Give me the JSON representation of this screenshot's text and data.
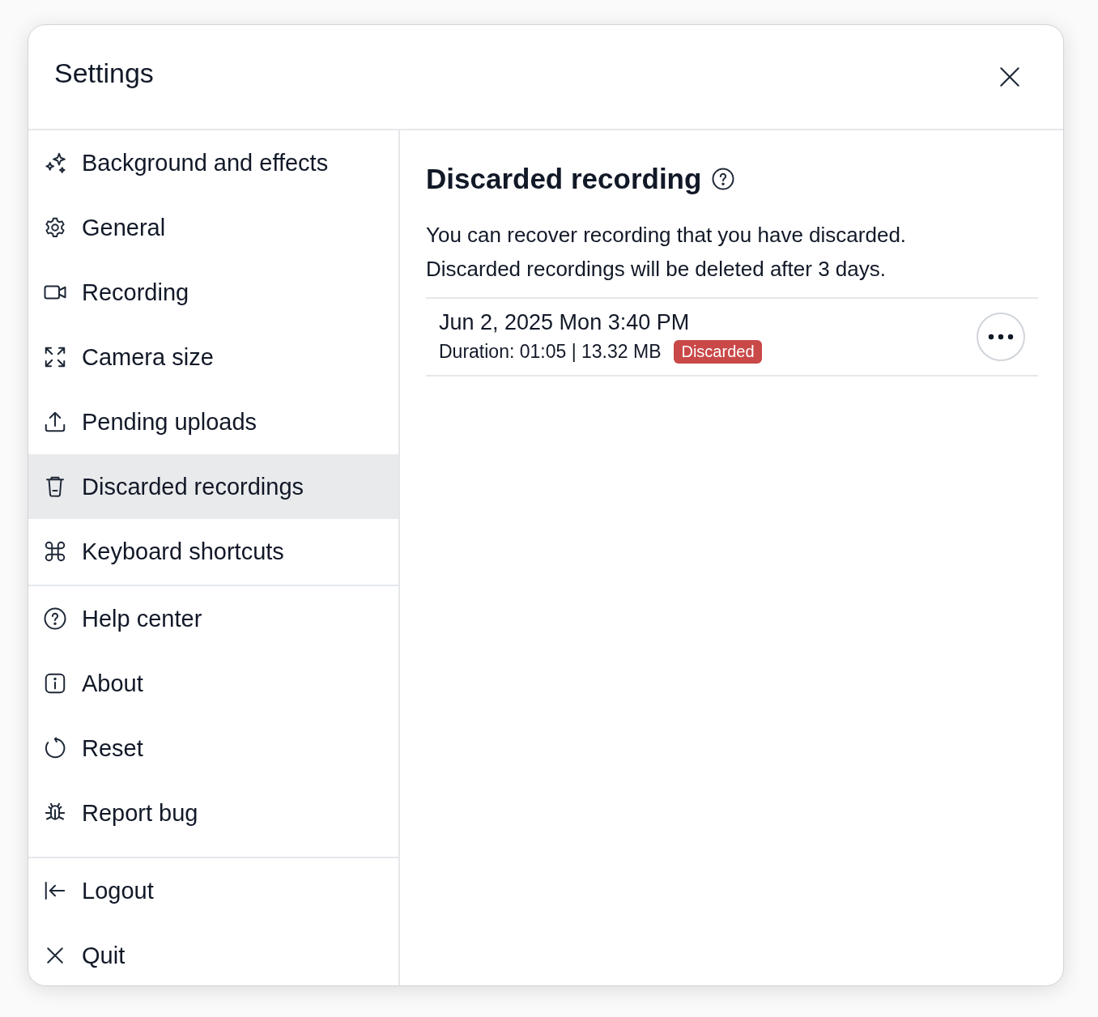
{
  "window": {
    "title": "Settings"
  },
  "sidebar": {
    "groups": [
      {
        "items": [
          {
            "label": "Background and effects",
            "selected": false
          },
          {
            "label": "General",
            "selected": false
          },
          {
            "label": "Recording",
            "selected": false
          },
          {
            "label": "Camera size",
            "selected": false
          },
          {
            "label": "Pending uploads",
            "selected": false
          },
          {
            "label": "Discarded recordings",
            "selected": true
          },
          {
            "label": "Keyboard shortcuts",
            "selected": false
          }
        ]
      },
      {
        "items": [
          {
            "label": "Help center",
            "selected": false
          },
          {
            "label": "About",
            "selected": false
          },
          {
            "label": "Reset",
            "selected": false
          },
          {
            "label": "Report bug",
            "selected": false
          }
        ]
      },
      {
        "items": [
          {
            "label": "Logout",
            "selected": false
          },
          {
            "label": "Quit",
            "selected": false
          }
        ]
      }
    ]
  },
  "content": {
    "heading": "Discarded recording",
    "description_lines": [
      "You can recover recording that you have discarded.",
      "Discarded recordings will be deleted after 3 days."
    ],
    "recordings": [
      {
        "title": "Jun 2, 2025 Mon 3:40 PM",
        "details": "Duration: 01:05 | 13.32 MB",
        "status": "Discarded"
      }
    ]
  }
}
